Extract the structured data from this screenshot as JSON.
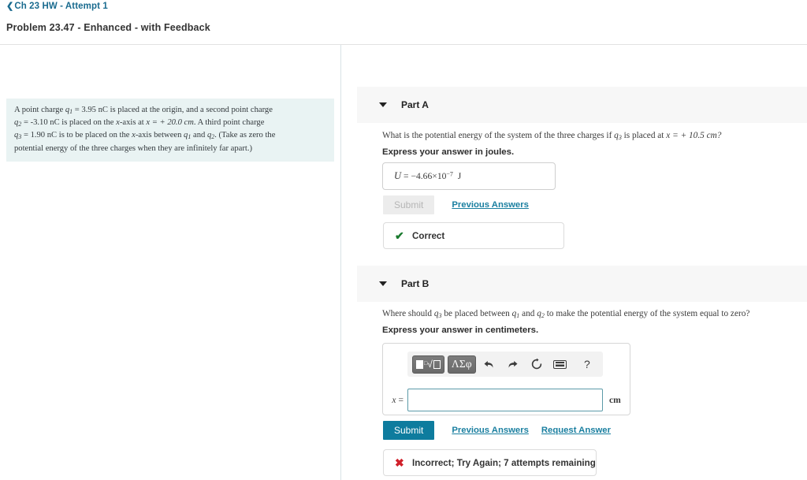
{
  "header": {
    "breadcrumb_chevron": "chevron-left-icon",
    "breadcrumb_label": "Ch 23 HW - Attempt 1",
    "problem_title": "Problem 23.47 - Enhanced - with Feedback"
  },
  "problem": {
    "line1_a": "A point charge ",
    "q1": "q",
    "q1_sub": "1",
    "line1_b": " = 3.95 nC is placed at the origin, and a second point charge",
    "line2_a": "q",
    "q2_sub": "2",
    "line2_b": " = -3.10 nC is placed on the ",
    "line2_x": "x",
    "line2_c": "-axis at ",
    "line2_eq": "x = + 20.0 cm",
    "line2_d": ". A third point charge",
    "line3_a": "q",
    "q3_sub": "3",
    "line3_b": " = 1.90 nC is to be placed on the ",
    "line3_x": "x",
    "line3_c": "-axis between ",
    "line3_q1": "q",
    "line3_q1_sub": "1",
    "line3_and": " and ",
    "line3_q2": "q",
    "line3_q2_sub": "2",
    "line3_d": ". (Take as zero the",
    "line4": "potential energy of the three charges when they are infinitely far apart.)"
  },
  "part_a": {
    "caret_icon": "caret-down-icon",
    "label": "Part A",
    "question_a": "What is the potential energy of the system of the three charges if ",
    "question_q3": "q",
    "question_q3_sub": "3",
    "question_b": " is placed at ",
    "question_x": "x",
    "question_eq": " = + 10.5 cm?",
    "express": "Express your answer in joules.",
    "answer_symbol": "U",
    "answer_equals": " = ",
    "answer_mantissa": "−4.66×10",
    "answer_exponent": "−7",
    "answer_unit": "J",
    "submit_label": "Submit",
    "submit_disabled": true,
    "previous_answers_label": "Previous Answers",
    "feedback_icon": "check-mark-icon",
    "feedback_text": "Correct"
  },
  "part_b": {
    "caret_icon": "caret-down-icon",
    "label": "Part B",
    "question_a": "Where should ",
    "question_q3": "q",
    "question_q3_sub": "3",
    "question_b": " be placed between ",
    "question_q1": "q",
    "question_q1_sub": "1",
    "question_and": " and ",
    "question_q2": "q",
    "question_q2_sub": "2",
    "question_c": " to make the potential energy of the system equal to zero?",
    "express": "Express your answer in centimeters.",
    "toolbar": {
      "template_button": "math-template-icon",
      "greek_button": "ΛΣφ",
      "undo_icon": "undo-arrow-icon",
      "redo_icon": "redo-arrow-icon",
      "reset_icon": "reset-circular-arrow-icon",
      "keyboard_icon": "keyboard-icon",
      "help_label": "?"
    },
    "input_symbol": "x",
    "input_equals": " =",
    "input_value": "",
    "input_placeholder": "",
    "input_unit": "cm",
    "submit_label": "Submit",
    "previous_answers_label": "Previous Answers",
    "request_answer_label": "Request Answer",
    "feedback_icon": "cross-mark-icon",
    "feedback_text": "Incorrect; Try Again; 7 attempts remaining"
  },
  "colors": {
    "link": "#1a7fa0",
    "submit": "#0e7c9e",
    "problem_bg": "#e9f3f3",
    "part_band": "#f7f7f7",
    "correct": "#1a7a2e",
    "incorrect": "#d0202a"
  }
}
